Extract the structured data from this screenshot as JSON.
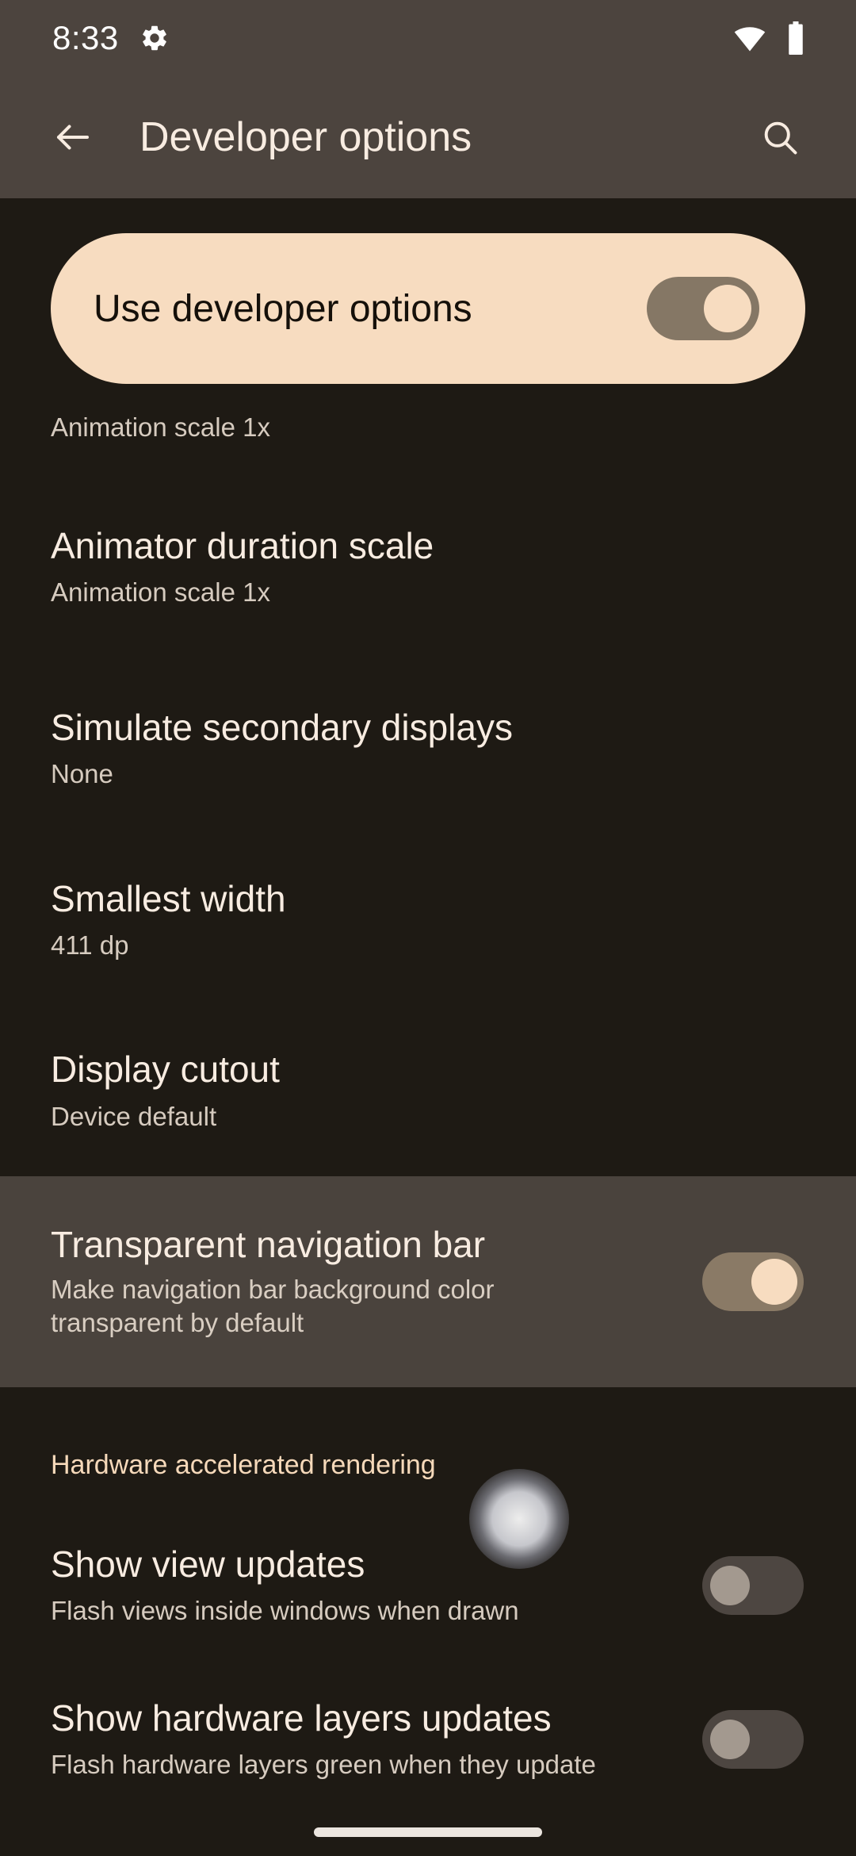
{
  "colors": {
    "background": "#1e1a14",
    "app_bar": "#4c443e",
    "card": "#f7dcc0",
    "accent_text": "#f6d9ba",
    "title_text": "#f8ece1",
    "summary_text": "#d6cbbf",
    "highlight_row": "#4a433d",
    "switch_on_track": "#8a7a66",
    "switch_on_thumb": "#f7dcc0",
    "switch_off_track": "#4d4641",
    "switch_off_thumb": "#a3998f"
  },
  "status_bar": {
    "time": "8:33",
    "icons": [
      "settings-gear-icon",
      "wifi-icon",
      "battery-icon"
    ]
  },
  "app_bar": {
    "back_icon": "back-arrow-icon",
    "title": "Developer options",
    "search_icon": "search-icon"
  },
  "master_switch": {
    "label": "Use developer options",
    "state": "on"
  },
  "list": [
    {
      "title": "",
      "summary": "Animation scale 1x",
      "partial": true,
      "switch": null
    },
    {
      "title": "Animator duration scale",
      "summary": "Animation scale 1x",
      "switch": null
    },
    {
      "title": "Simulate secondary displays",
      "summary": "None",
      "switch": null
    },
    {
      "title": "Smallest width",
      "summary": "411 dp",
      "switch": null
    },
    {
      "title": "Display cutout",
      "summary": "Device default",
      "switch": null
    },
    {
      "title": "Transparent navigation bar",
      "summary": "Make navigation bar background color transparent by default",
      "highlighted": true,
      "switch": "on"
    }
  ],
  "section": {
    "header": "Hardware accelerated rendering",
    "items": [
      {
        "title": "Show view updates",
        "summary": "Flash views inside windows when drawn",
        "switch": "off"
      },
      {
        "title": "Show hardware layers updates",
        "summary": "Flash hardware layers green when they update",
        "switch": "off"
      }
    ]
  },
  "nav_bar": {
    "type": "gesture-home-indicator"
  }
}
